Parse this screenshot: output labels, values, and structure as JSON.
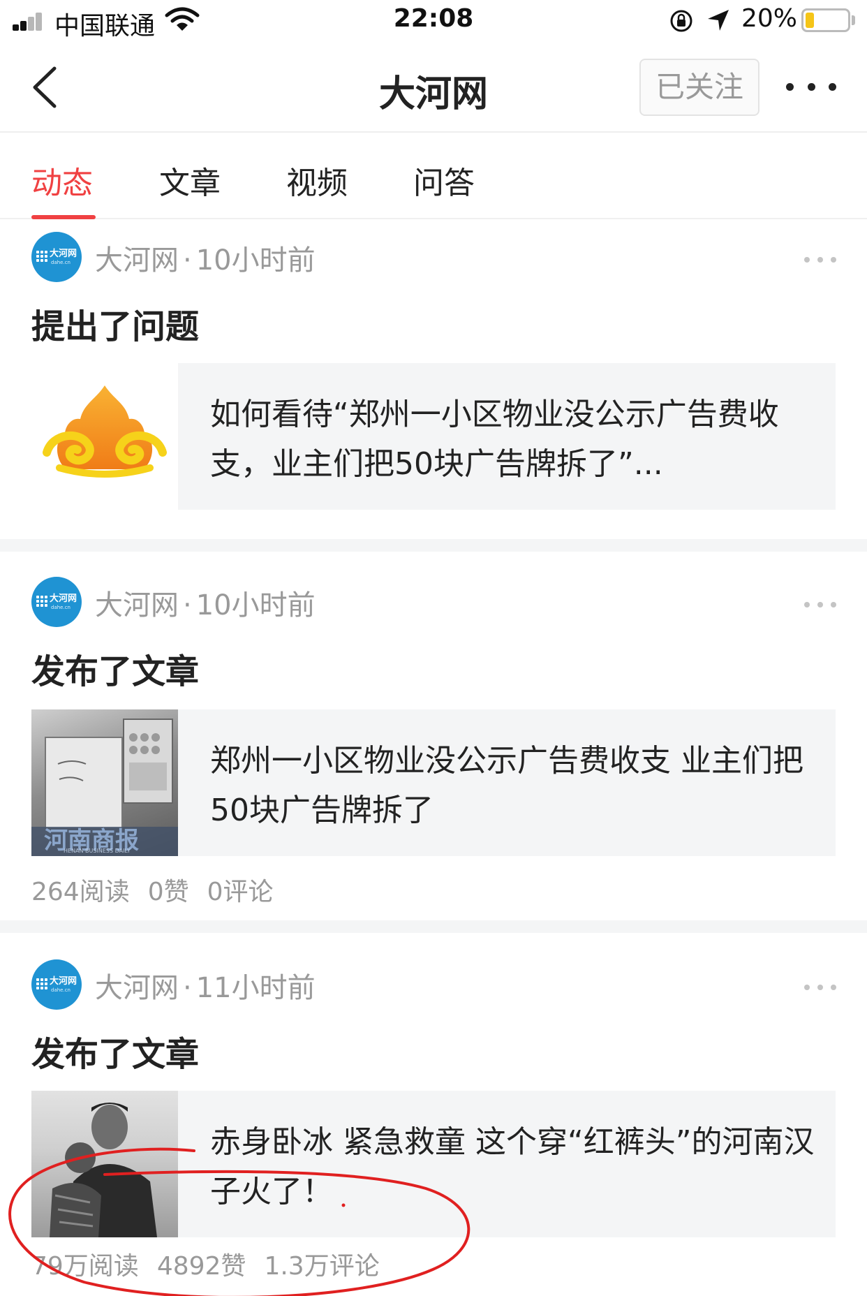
{
  "status_bar": {
    "carrier": "中国联通",
    "time": "22:08",
    "battery_percent": "20%",
    "battery_level": 0.2,
    "icons": [
      "signal-icon",
      "wifi-icon",
      "orientation-lock-icon",
      "location-arrow-icon",
      "battery-icon"
    ]
  },
  "nav": {
    "title": "大河网",
    "follow_label": "已关注",
    "icons": [
      "back-chevron-icon",
      "more-dots-icon"
    ]
  },
  "tabs": [
    {
      "label": "动态",
      "active": true
    },
    {
      "label": "文章",
      "active": false
    },
    {
      "label": "视频",
      "active": false
    },
    {
      "label": "问答",
      "active": false
    }
  ],
  "colors": {
    "accent": "#f04142",
    "avatar_blue": "#1f93d3",
    "meta_gray": "#999999",
    "card_bg": "#f4f5f6",
    "battery_yellow": "#f5c518"
  },
  "feed": [
    {
      "author": "大河网",
      "dot": "·",
      "time": "10小时前",
      "action": "提出了问题",
      "title": "如何看待“郑州一小区物业没公示广告费收支，业主们把50块广告牌拆了”...",
      "thumbnail": "wukong-qa-logo-icon"
    },
    {
      "author": "大河网",
      "dot": "·",
      "time": "10小时前",
      "action": "发布了文章",
      "title": "郑州一小区物业没公示广告费收支 业主们把50块广告牌拆了",
      "thumbnail": "news-photo-notice-board",
      "thumb_watermark": "河南商报",
      "thumb_watermark_sub": "HENAN BUSINESS DAILY",
      "stats": {
        "reads": "264阅读",
        "likes": "0赞",
        "comments": "0评论"
      }
    },
    {
      "author": "大河网",
      "dot": "·",
      "time": "11小时前",
      "action": "发布了文章",
      "title": "赤身卧冰 紧急救童 这个穿“红裤头”的河南汉子火了！",
      "thumbnail": "news-photo-man-child",
      "stats": {
        "reads": "79万阅读",
        "likes": "4892赞",
        "comments": "1.3万评论"
      }
    }
  ],
  "avatar_text": {
    "name": "大河网",
    "domain": "dahe.cn"
  }
}
